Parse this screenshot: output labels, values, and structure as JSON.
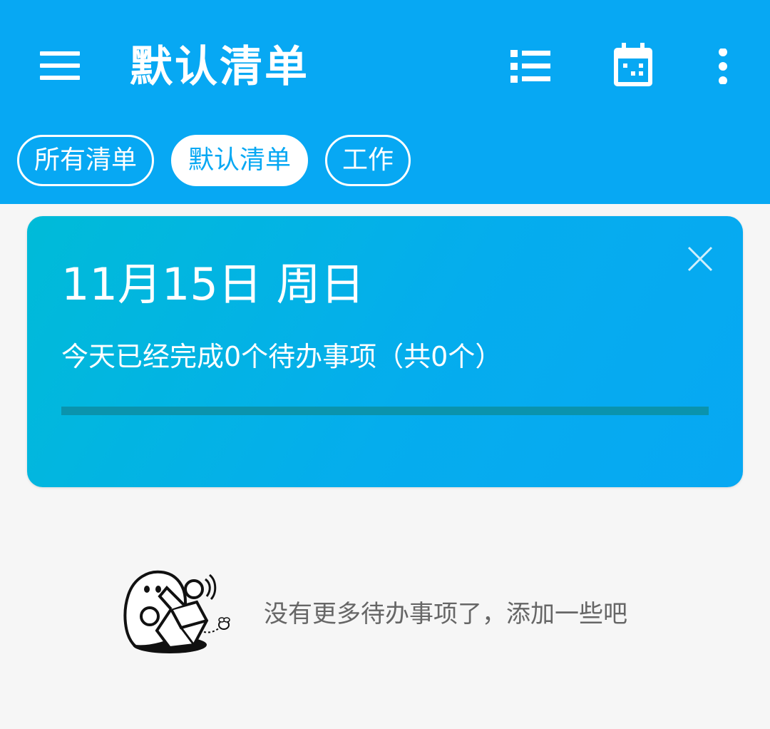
{
  "appbar": {
    "title": "默认清单",
    "menu_icon": "hamburger-menu-icon",
    "list_icon": "list-view-icon",
    "calendar_icon": "calendar-icon",
    "more_icon": "more-vert-icon",
    "background_color": "#07a8f3"
  },
  "chips": [
    {
      "label": "所有清单",
      "active": false
    },
    {
      "label": "默认清单",
      "active": true
    },
    {
      "label": "工作",
      "active": false
    }
  ],
  "summary_card": {
    "date": "11月15日 周日",
    "summary": "今天已经完成0个待办事项（共0个）",
    "progress": 0,
    "close_icon": "close-icon"
  },
  "empty_state": {
    "text": "没有更多待办事项了，添加一些吧",
    "illustration": "ghost-opening-box-illustration"
  }
}
